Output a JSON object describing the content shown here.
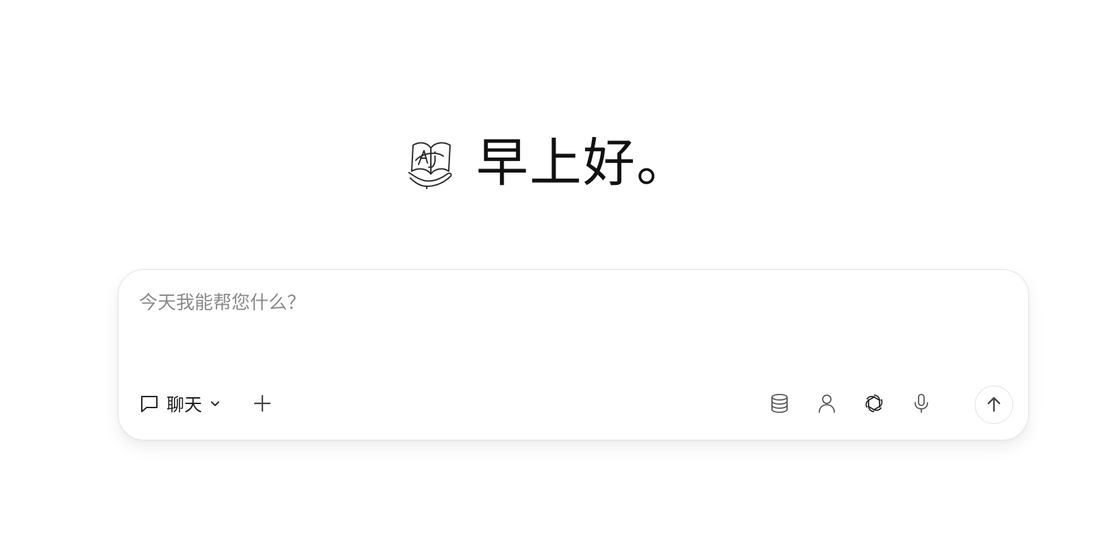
{
  "greeting": {
    "logo_icon": "aj-book-hand-logo",
    "text": "早上好。"
  },
  "composer": {
    "placeholder": "今天我能帮您什么？",
    "value": "",
    "mode": {
      "icon": "chat-bubble-icon",
      "label": "聊天",
      "dropdown_icon": "chevron-down-icon"
    },
    "add_icon": "plus-icon",
    "tools": [
      {
        "icon": "database-icon"
      },
      {
        "icon": "user-icon"
      },
      {
        "icon": "openai-icon"
      },
      {
        "icon": "microphone-icon"
      }
    ],
    "send_icon": "arrow-up-icon"
  },
  "colors": {
    "text": "#111111",
    "placeholder": "#8a8a8a",
    "icon": "#555555",
    "border": "#e3e3e3"
  }
}
